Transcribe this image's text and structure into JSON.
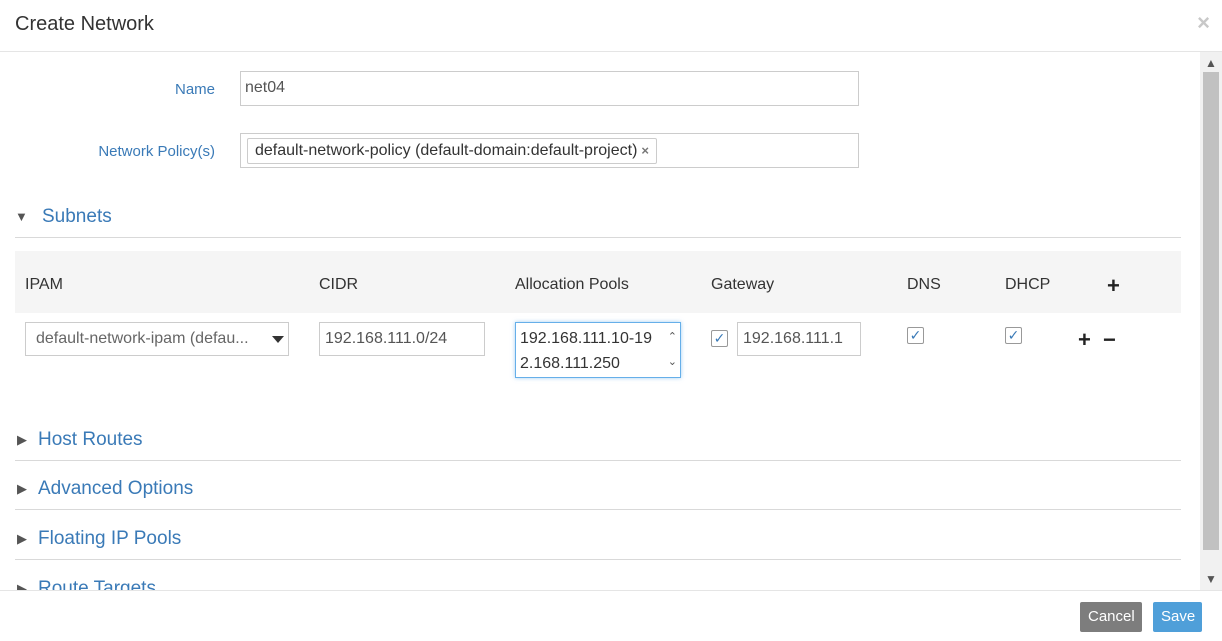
{
  "dialog": {
    "title": "Create Network",
    "close_icon": "close-icon"
  },
  "form": {
    "name_label": "Name",
    "name_value": "net04",
    "policy_label": "Network Policy(s)",
    "policy_tag": "default-network-policy (default-domain:default-project)",
    "policy_tag_remove": "×"
  },
  "subnets": {
    "title": "Subnets",
    "columns": {
      "ipam": "IPAM",
      "cidr": "CIDR",
      "pools": "Allocation Pools",
      "gateway": "Gateway",
      "dns": "DNS",
      "dhcp": "DHCP"
    },
    "row": {
      "ipam": "default-network-ipam (defau...",
      "cidr": "192.168.111.0/24",
      "pools_line1": "192.168.111.10-19",
      "pools_line2": "2.168.111.250",
      "gateway_checked": true,
      "gateway": "192.168.111.1",
      "dns_checked": true,
      "dhcp_checked": true
    },
    "add_symbol": "+",
    "remove_symbol": "−"
  },
  "sections": {
    "host_routes": "Host Routes",
    "advanced": "Advanced Options",
    "floating": "Floating IP Pools",
    "route_targets": "Route Targets"
  },
  "footer": {
    "cancel": "Cancel",
    "save": "Save"
  },
  "colors": {
    "accent": "#3a7ab7",
    "save": "#4f9fd9",
    "cancel": "#7d7d7d"
  }
}
